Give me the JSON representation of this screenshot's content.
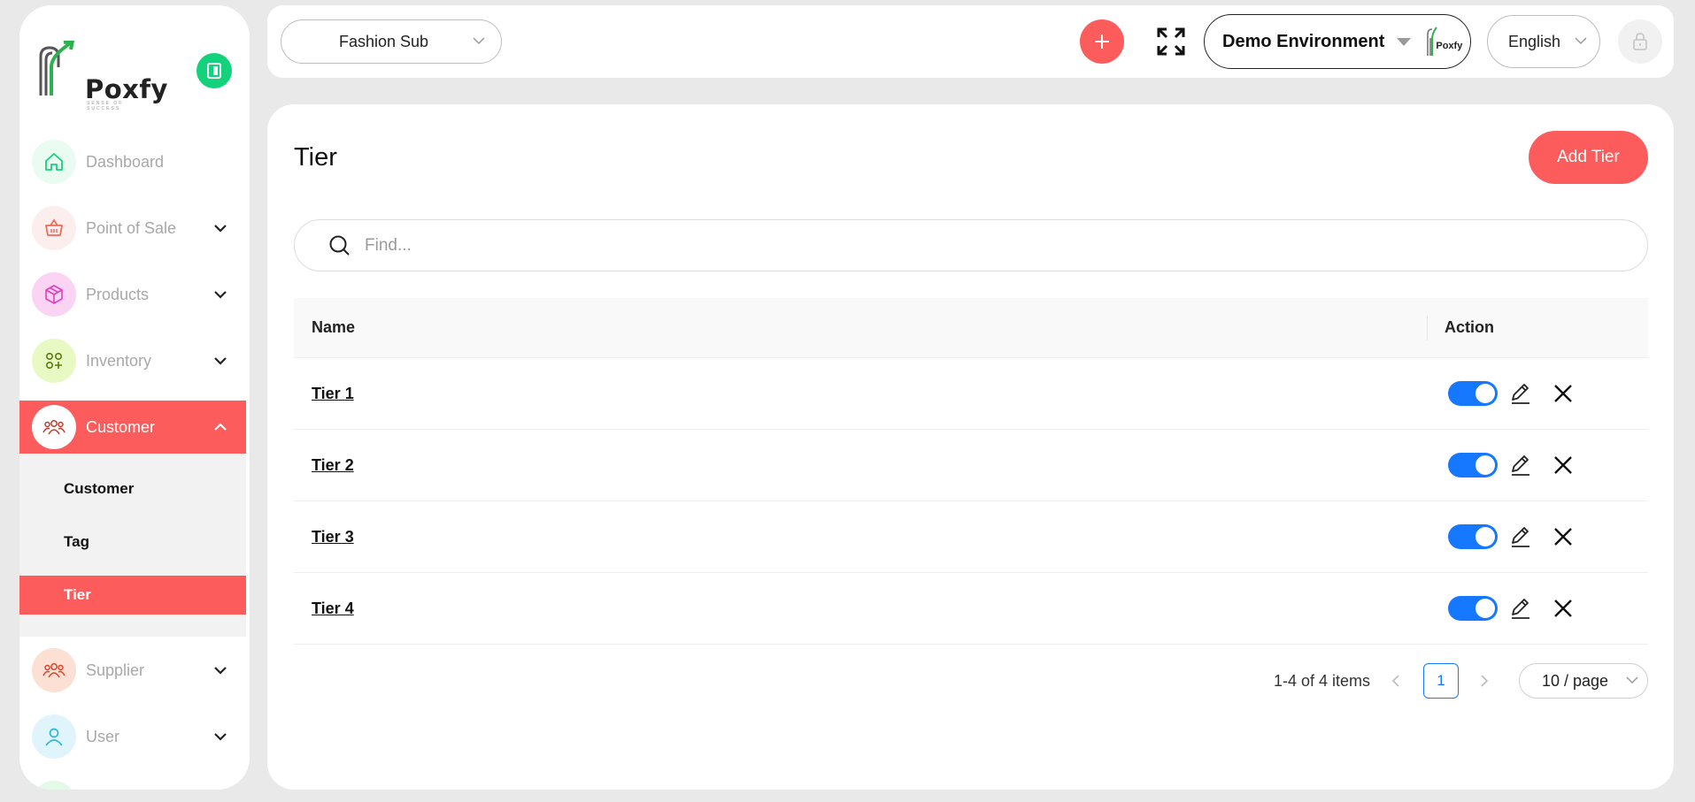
{
  "sidebar": {
    "logo_text": "Poxfy",
    "logo_tagline": "SENSE OF SUCCESS",
    "items": [
      {
        "label": "Dashboard",
        "icon": "home-icon",
        "color": "#13d27b",
        "bg": "#eafbf1"
      },
      {
        "label": "Point of Sale",
        "icon": "basket-icon",
        "color": "#f06a5a",
        "bg": "#fdeeee"
      },
      {
        "label": "Products",
        "icon": "box-icon",
        "color": "#e040c0",
        "bg": "#fbd4f4"
      },
      {
        "label": "Inventory",
        "icon": "grid-plus-icon",
        "color": "#5b7a10",
        "bg": "#e9f9c4"
      },
      {
        "label": "Customer",
        "icon": "users-icon",
        "color": "#e05a3a",
        "bg": "#ffffff"
      },
      {
        "label": "Supplier",
        "icon": "users-icon",
        "color": "#d9452a",
        "bg": "#fde0d4"
      },
      {
        "label": "User",
        "icon": "user-icon",
        "color": "#2ab7d9",
        "bg": "#dff5fb"
      }
    ],
    "submenu": [
      {
        "label": "Customer"
      },
      {
        "label": "Tag"
      },
      {
        "label": "Tier"
      }
    ]
  },
  "topbar": {
    "store_select": "Fashion Sub",
    "environment_select": "Demo Environment",
    "env_logo_text": "Poxfy",
    "language_select": "English"
  },
  "main": {
    "title": "Tier",
    "add_button": "Add Tier",
    "search_placeholder": "Find...",
    "table": {
      "columns": [
        "Name",
        "Action"
      ],
      "rows": [
        {
          "name": "Tier 1",
          "enabled": true
        },
        {
          "name": "Tier 2",
          "enabled": true
        },
        {
          "name": "Tier 3",
          "enabled": true
        },
        {
          "name": "Tier 4",
          "enabled": true
        }
      ]
    },
    "pagination": {
      "range": "1-4 of 4 items",
      "current_page": "1",
      "page_size": "10 / page"
    }
  },
  "colors": {
    "accent": "#fd5c5c",
    "primary_blue": "#1677ff",
    "green": "#13d27b"
  }
}
